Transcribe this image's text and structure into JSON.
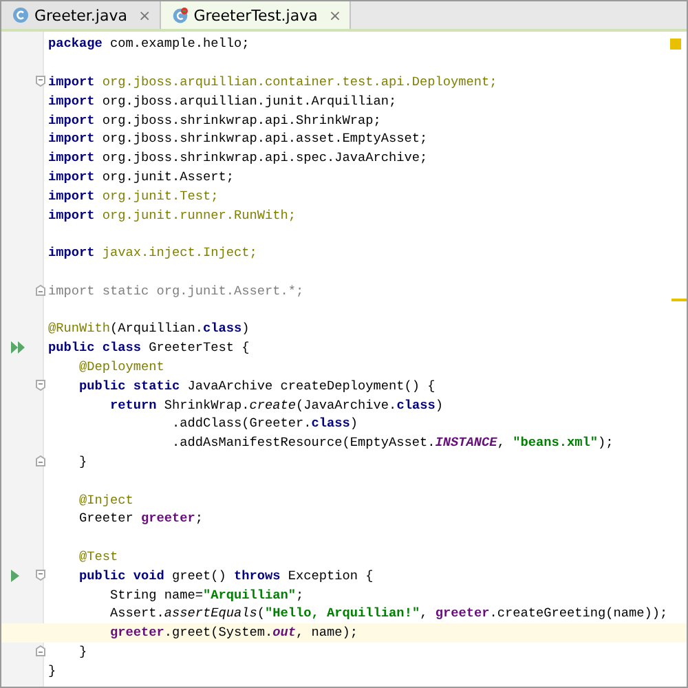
{
  "tabs": [
    {
      "label": "Greeter.java",
      "close": "×",
      "selected": false
    },
    {
      "label": "GreeterTest.java",
      "close": "×",
      "selected": true
    }
  ],
  "editor": {
    "lines": [
      {
        "run_all": false,
        "run": false,
        "fold_start": false,
        "fold_end": false,
        "current": false,
        "tokens": [
          {
            "text": "package",
            "kind": "keyword"
          },
          {
            "text": " com.example.hello;",
            "kind": "plain"
          }
        ]
      },
      {
        "run_all": false,
        "run": false,
        "fold_start": false,
        "fold_end": false,
        "current": false
      },
      {
        "run_all": false,
        "run": false,
        "fold_start": true,
        "fold_end": false,
        "current": false,
        "tokens": [
          {
            "text": "import",
            "kind": "keyword"
          },
          {
            "text": " org.jboss.arquillian.container.test.api.Deployment;",
            "kind": "unused"
          }
        ]
      },
      {
        "run_all": false,
        "run": false,
        "fold_start": false,
        "fold_end": false,
        "current": false,
        "tokens": [
          {
            "text": "import",
            "kind": "keyword"
          },
          {
            "text": " org.jboss.arquillian.junit.Arquillian;",
            "kind": "plain"
          }
        ]
      },
      {
        "run_all": false,
        "run": false,
        "fold_start": false,
        "fold_end": false,
        "current": false,
        "tokens": [
          {
            "text": "import",
            "kind": "keyword"
          },
          {
            "text": " org.jboss.shrinkwrap.api.ShrinkWrap;",
            "kind": "plain"
          }
        ]
      },
      {
        "run_all": false,
        "run": false,
        "fold_start": false,
        "fold_end": false,
        "current": false,
        "tokens": [
          {
            "text": "import",
            "kind": "keyword"
          },
          {
            "text": " org.jboss.shrinkwrap.api.asset.EmptyAsset;",
            "kind": "plain"
          }
        ]
      },
      {
        "run_all": false,
        "run": false,
        "fold_start": false,
        "fold_end": false,
        "current": false,
        "tokens": [
          {
            "text": "import",
            "kind": "keyword"
          },
          {
            "text": " org.jboss.shrinkwrap.api.spec.JavaArchive;",
            "kind": "plain"
          }
        ]
      },
      {
        "run_all": false,
        "run": false,
        "fold_start": false,
        "fold_end": false,
        "current": false,
        "tokens": [
          {
            "text": "import",
            "kind": "keyword"
          },
          {
            "text": " org.junit.Assert;",
            "kind": "plain"
          }
        ]
      },
      {
        "run_all": false,
        "run": false,
        "fold_start": false,
        "fold_end": false,
        "current": false,
        "tokens": [
          {
            "text": "import",
            "kind": "keyword"
          },
          {
            "text": " org.junit.Test;",
            "kind": "unused"
          }
        ]
      },
      {
        "run_all": false,
        "run": false,
        "fold_start": false,
        "fold_end": false,
        "current": false,
        "tokens": [
          {
            "text": "import",
            "kind": "keyword"
          },
          {
            "text": " org.junit.runner.RunWith;",
            "kind": "unused"
          }
        ]
      },
      {
        "run_all": false,
        "run": false,
        "fold_start": false,
        "fold_end": false,
        "current": false
      },
      {
        "run_all": false,
        "run": false,
        "fold_start": false,
        "fold_end": false,
        "current": false,
        "tokens": [
          {
            "text": "import",
            "kind": "keyword"
          },
          {
            "text": " javax.inject.Inject;",
            "kind": "unused"
          }
        ]
      },
      {
        "run_all": false,
        "run": false,
        "fold_start": false,
        "fold_end": false,
        "current": false
      },
      {
        "run_all": false,
        "run": false,
        "fold_start": false,
        "fold_end": true,
        "current": false,
        "tokens": [
          {
            "text": "import static org.junit.Assert.*;",
            "kind": "unused-static"
          }
        ]
      },
      {
        "run_all": false,
        "run": false,
        "fold_start": false,
        "fold_end": false,
        "current": false
      },
      {
        "run_all": false,
        "run": false,
        "fold_start": false,
        "fold_end": false,
        "current": false,
        "tokens": [
          {
            "text": "@RunWith",
            "kind": "annotation"
          },
          {
            "text": "(Arquillian.",
            "kind": "plain"
          },
          {
            "text": "class",
            "kind": "keyword"
          },
          {
            "text": ")",
            "kind": "plain"
          }
        ]
      },
      {
        "run_all": true,
        "run": false,
        "fold_start": false,
        "fold_end": false,
        "current": false,
        "tokens": [
          {
            "text": "public class",
            "kind": "keyword"
          },
          {
            "text": " GreeterTest {",
            "kind": "plain"
          }
        ]
      },
      {
        "run_all": false,
        "run": false,
        "fold_start": false,
        "fold_end": false,
        "current": false,
        "tokens": [
          {
            "text": "    @Deployment",
            "kind": "annotation"
          }
        ]
      },
      {
        "run_all": false,
        "run": false,
        "fold_start": true,
        "fold_end": false,
        "current": false,
        "tokens": [
          {
            "text": "    public static",
            "kind": "keyword"
          },
          {
            "text": " JavaArchive createDeployment() {",
            "kind": "plain"
          }
        ]
      },
      {
        "run_all": false,
        "run": false,
        "fold_start": false,
        "fold_end": false,
        "current": false,
        "tokens": [
          {
            "text": "        return",
            "kind": "keyword"
          },
          {
            "text": " ShrinkWrap.",
            "kind": "plain"
          },
          {
            "text": "create",
            "kind": "static-method"
          },
          {
            "text": "(JavaArchive.",
            "kind": "plain"
          },
          {
            "text": "class",
            "kind": "keyword"
          },
          {
            "text": ")",
            "kind": "plain"
          }
        ]
      },
      {
        "run_all": false,
        "run": false,
        "fold_start": false,
        "fold_end": false,
        "current": false,
        "tokens": [
          {
            "text": "                .addClass(Greeter.",
            "kind": "plain"
          },
          {
            "text": "class",
            "kind": "keyword"
          },
          {
            "text": ")",
            "kind": "plain"
          }
        ]
      },
      {
        "run_all": false,
        "run": false,
        "fold_start": false,
        "fold_end": false,
        "current": false,
        "tokens": [
          {
            "text": "                .addAsManifestResource(EmptyAsset.",
            "kind": "plain"
          },
          {
            "text": "INSTANCE",
            "kind": "static-field"
          },
          {
            "text": ", ",
            "kind": "plain"
          },
          {
            "text": "\"beans.xml\"",
            "kind": "string"
          },
          {
            "text": ");",
            "kind": "plain"
          }
        ]
      },
      {
        "run_all": false,
        "run": false,
        "fold_start": false,
        "fold_end": true,
        "current": false,
        "tokens": [
          {
            "text": "    }",
            "kind": "plain"
          }
        ]
      },
      {
        "run_all": false,
        "run": false,
        "fold_start": false,
        "fold_end": false,
        "current": false
      },
      {
        "run_all": false,
        "run": false,
        "fold_start": false,
        "fold_end": false,
        "current": false,
        "tokens": [
          {
            "text": "    @Inject",
            "kind": "annotation"
          }
        ]
      },
      {
        "run_all": false,
        "run": false,
        "fold_start": false,
        "fold_end": false,
        "current": false,
        "tokens": [
          {
            "text": "    Greeter ",
            "kind": "plain"
          },
          {
            "text": "greeter",
            "kind": "field"
          },
          {
            "text": ";",
            "kind": "plain"
          }
        ]
      },
      {
        "run_all": false,
        "run": false,
        "fold_start": false,
        "fold_end": false,
        "current": false
      },
      {
        "run_all": false,
        "run": false,
        "fold_start": false,
        "fold_end": false,
        "current": false,
        "tokens": [
          {
            "text": "    @Test",
            "kind": "annotation"
          }
        ]
      },
      {
        "run_all": false,
        "run": true,
        "fold_start": true,
        "fold_end": false,
        "current": false,
        "tokens": [
          {
            "text": "    public void",
            "kind": "keyword"
          },
          {
            "text": " greet() ",
            "kind": "plain"
          },
          {
            "text": "throws",
            "kind": "keyword"
          },
          {
            "text": " Exception {",
            "kind": "plain"
          }
        ]
      },
      {
        "run_all": false,
        "run": false,
        "fold_start": false,
        "fold_end": false,
        "current": false,
        "tokens": [
          {
            "text": "        String name=",
            "kind": "plain"
          },
          {
            "text": "\"Arquillian\"",
            "kind": "string"
          },
          {
            "text": ";",
            "kind": "plain"
          }
        ]
      },
      {
        "run_all": false,
        "run": false,
        "fold_start": false,
        "fold_end": false,
        "current": false,
        "tokens": [
          {
            "text": "        Assert.",
            "kind": "plain"
          },
          {
            "text": "assertEquals",
            "kind": "static-method"
          },
          {
            "text": "(",
            "kind": "plain"
          },
          {
            "text": "\"Hello, Arquillian!\"",
            "kind": "string"
          },
          {
            "text": ", ",
            "kind": "plain"
          },
          {
            "text": "greeter",
            "kind": "field"
          },
          {
            "text": ".createGreeting(name));",
            "kind": "plain"
          }
        ]
      },
      {
        "run_all": false,
        "run": false,
        "fold_start": false,
        "fold_end": false,
        "current": true,
        "tokens": [
          {
            "text": "        greeter",
            "kind": "field"
          },
          {
            "text": ".greet(System.",
            "kind": "plain"
          },
          {
            "text": "out",
            "kind": "static-field"
          },
          {
            "text": ", name);",
            "kind": "plain"
          }
        ]
      },
      {
        "run_all": false,
        "run": false,
        "fold_start": false,
        "fold_end": true,
        "current": false,
        "tokens": [
          {
            "text": "    }",
            "kind": "plain"
          }
        ]
      },
      {
        "run_all": false,
        "run": false,
        "fold_start": false,
        "fold_end": false,
        "current": false,
        "tokens": [
          {
            "text": "}",
            "kind": "plain"
          }
        ]
      }
    ]
  }
}
